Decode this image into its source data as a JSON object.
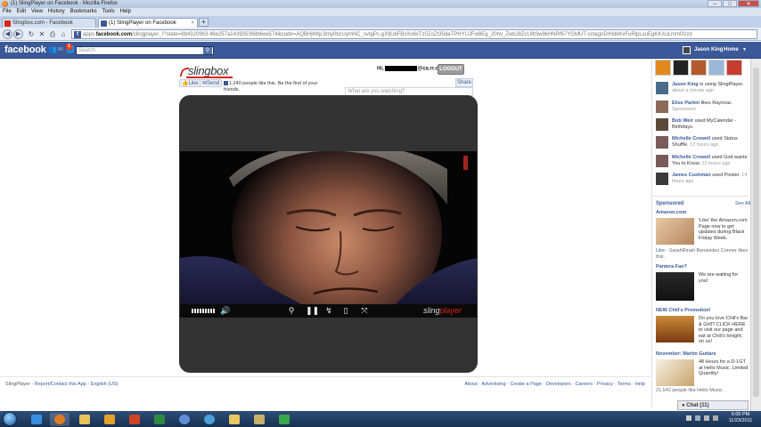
{
  "window": {
    "title": "(1) SlingPlayer on Facebook - Mozilla Firefox",
    "buttons": [
      "–",
      "□",
      "✕"
    ]
  },
  "menubar": [
    "File",
    "Edit",
    "View",
    "History",
    "Bookmarks",
    "Tools",
    "Help"
  ],
  "tabs": [
    {
      "label": "Slingbox.com - Facebook",
      "active": false
    },
    {
      "label": "(1) SlingPlayer on Facebook",
      "active": true
    }
  ],
  "newtab_label": "+",
  "urlbar": {
    "prefix": "apps.",
    "domain": "facebook.com",
    "path": "/slingplayer_/?state=8b4320963 48e257a143935368b6ee574&code=AQBHjWtjL9my0bcUymNC_svtgPc-gXfjUkFBxXo6xTz0ZoZt35daTPHYUJFw9Eg_20hv_ZwbJ8ZcU8t3w9kHNRf67YGMUT-cxtagnDrHdkKvFuRlpLxuEgKKXuLmm0Vzd"
  },
  "facebook": {
    "logo": "facebook",
    "notification_count": "1",
    "search_placeholder": "Search",
    "user_name": "Jason King",
    "home_label": "Home",
    "nav_dropdown": "▼"
  },
  "app": {
    "logo_text": "slingbox",
    "greeting_prefix": "Hi,",
    "greeting_suffix": "@ca.rr.com",
    "logout_label": "LOGOUT",
    "like_label": "Like",
    "send_label": "Send",
    "like_text": "1,240 people like this. Be the first of your friends.",
    "share_label": "Share",
    "search_placeholder": "What are you watching?",
    "player_brand_a": "sling",
    "player_brand_b": "player"
  },
  "footer": {
    "left": [
      "SlingPlayer",
      "Report/Contact this App",
      "English (US)"
    ],
    "right": [
      "About",
      "Advertising",
      "Create a Page",
      "Developers",
      "Careers",
      "Privacy",
      "Terms",
      "Help"
    ]
  },
  "ticker": [
    {
      "name": "Jason King",
      "text": "is using SlingPlayer.",
      "time": "about a minute ago"
    },
    {
      "name": "Elise Parkin",
      "text": "likes Rayovac.",
      "time": "Sponsored"
    },
    {
      "name": "Bob Weir",
      "text": "used MyCalendar - Birthdays.",
      "time": ""
    },
    {
      "name": "Michelle Crowell",
      "text": "used Status Shuffle.",
      "time": "12 hours ago"
    },
    {
      "name": "Michelle Crowell",
      "text": "used God wants You to Know.",
      "time": "12 hours ago"
    },
    {
      "name": "James Cushman",
      "text": "used Pixster.",
      "time": "14 hours ago"
    }
  ],
  "sponsored": {
    "heading": "Sponsored",
    "see_all": "See All",
    "ads": [
      {
        "title": "Amazon.com",
        "body": "'Like' the Amazon.com Page now to get updates during Black Friday Week.",
        "footer_like": "Like",
        "footer_text": "SarahRinah Benavides Conner likes this."
      },
      {
        "title": "Pantera Fan?",
        "body": "We are waiting for you!"
      },
      {
        "title": "NEW Chili's Promotion!",
        "body": "Do you love Chili's Bar & Grill? CLICK HERE to visit our page and eat at Chili's tonight, on us!"
      },
      {
        "title": "November: Martin Guitars",
        "body": "48 Hours for a D-1GT at Hello Music. Limited Quantity!",
        "footer_text": "21,542 people like Hello Music."
      }
    ]
  },
  "chat": {
    "label": "Chat (11)"
  },
  "clock": {
    "time": "6:00 PM",
    "date": "11/23/2011"
  },
  "colors": {
    "facebook_blue": "#3b5998",
    "sling_red": "#d6261a"
  }
}
